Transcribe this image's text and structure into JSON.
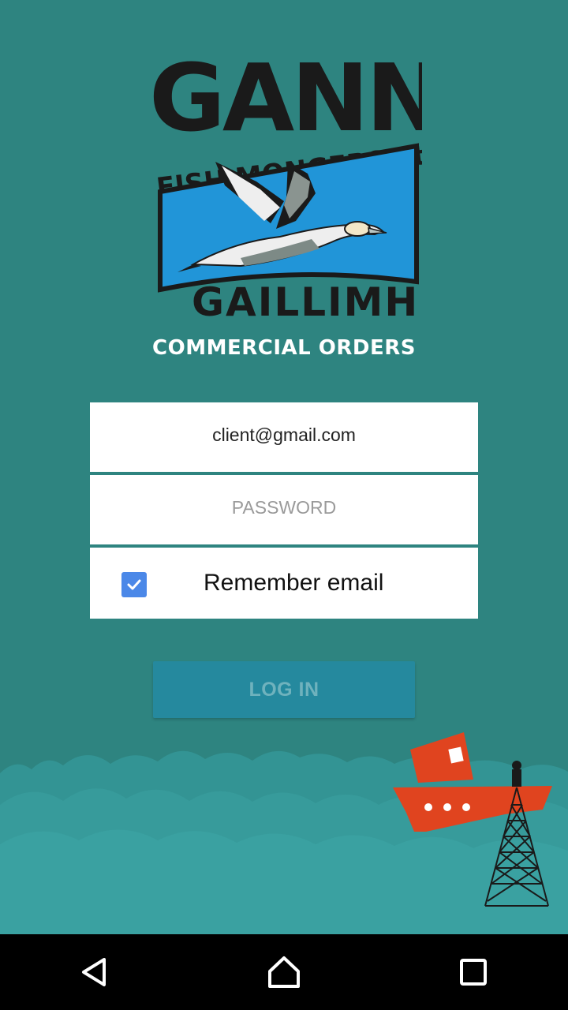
{
  "logo": {
    "brand": "GANNET",
    "tagline": "FISH MONGERS Ltd.",
    "city": "GAILLIMH"
  },
  "subtitle": "COMMERCIAL ORDERS",
  "form": {
    "email_value": "client@gmail.com",
    "password_placeholder": "PASSWORD",
    "remember_label": "Remember email",
    "remember_checked": true,
    "login_label": "LOG IN"
  },
  "colors": {
    "background": "#2e8480",
    "sea": "#3a9e9e",
    "checkbox": "#4b88e8",
    "button": "#25899e",
    "boat": "#e0441f"
  },
  "navbar": {
    "back_icon": "back-triangle-icon",
    "home_icon": "home-icon",
    "recents_icon": "recents-square-icon"
  }
}
